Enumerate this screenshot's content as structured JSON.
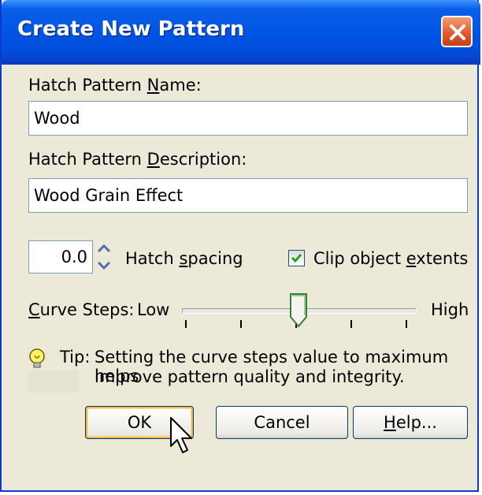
{
  "dialog": {
    "title": "Create New Pattern"
  },
  "name_field": {
    "label_before": "Hatch Pattern ",
    "label_underline": "N",
    "label_after": "ame:",
    "value": "Wood"
  },
  "description_field": {
    "label_before": "Hatch Pattern ",
    "label_underline": "D",
    "label_after": "escription:",
    "value": "Wood Grain Effect"
  },
  "spacing": {
    "value": "0.0",
    "label_before": "Hatch ",
    "label_underline": "s",
    "label_after": "pacing"
  },
  "clip_checkbox": {
    "checked": true,
    "label_before": "Clip object ",
    "label_underline": "e",
    "label_after": "xtents"
  },
  "curve_steps": {
    "label_underline": "C",
    "label_after": "urve Steps:",
    "low_label": "Low",
    "high_label": "High",
    "value_fraction": 0.5,
    "ticks": 6
  },
  "tip": {
    "prefix": "Tip:",
    "line1": "Setting the curve steps value to maximum helps",
    "line2": "improve pattern quality and integrity."
  },
  "buttons": {
    "ok": "OK",
    "cancel": "Cancel",
    "help_underline": "H",
    "help_after": "elp..."
  },
  "colors": {
    "titlebar": "#0055e5",
    "dialog_bg": "#ece9d8",
    "default_button_highlight": "#f8b33f"
  }
}
